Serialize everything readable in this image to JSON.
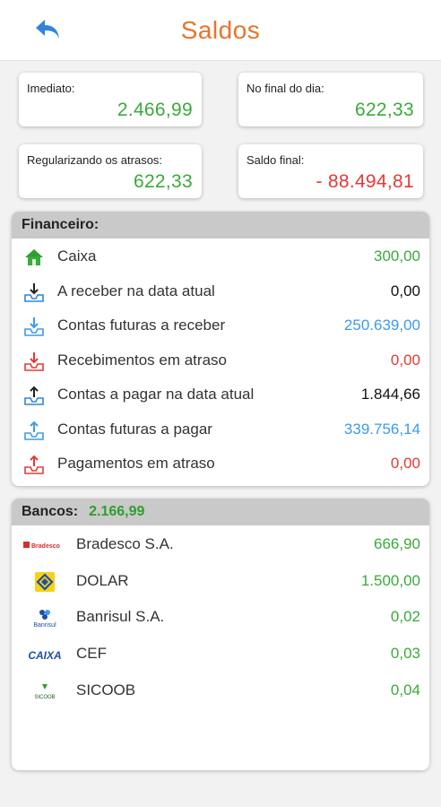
{
  "header": {
    "title": "Saldos",
    "back_icon": "back-arrow-icon"
  },
  "summary": {
    "imediato": {
      "label": "Imediato:",
      "value": "2.466,99"
    },
    "final_dia": {
      "label": "No final do dia:",
      "value": "622,33"
    },
    "regularizando": {
      "label": "Regularizando os atrasos:",
      "value": "622,33"
    },
    "saldo_final": {
      "label": "Saldo final:",
      "value": "- 88.494,81"
    }
  },
  "financeiro": {
    "title": "Financeiro:",
    "items": [
      {
        "label": "Caixa",
        "value": "300,00",
        "icon": "house-icon"
      },
      {
        "label": "A receber na data atual",
        "value": "0,00",
        "icon": "receive-today-icon"
      },
      {
        "label": "Contas futuras a receber",
        "value": "250.639,00",
        "icon": "receive-future-icon"
      },
      {
        "label": "Recebimentos em atraso",
        "value": "0,00",
        "icon": "receive-late-icon"
      },
      {
        "label": "Contas a pagar na data atual",
        "value": "1.844,66",
        "icon": "pay-today-icon"
      },
      {
        "label": "Contas futuras a pagar",
        "value": "339.756,14",
        "icon": "pay-future-icon"
      },
      {
        "label": "Pagamentos em atraso",
        "value": "0,00",
        "icon": "pay-late-icon"
      }
    ]
  },
  "bancos": {
    "title": "Bancos:",
    "total": "2.166,99",
    "items": [
      {
        "label": "Bradesco S.A.",
        "value": "666,90",
        "logo": "bradesco-logo",
        "logo_text": "Bradesco"
      },
      {
        "label": "DOLAR",
        "value": "1.500,00",
        "logo": "banco-do-brasil-logo"
      },
      {
        "label": "Banrisul S.A.",
        "value": "0,02",
        "logo": "banrisul-logo",
        "logo_text": "Banrisul"
      },
      {
        "label": "CEF",
        "value": "0,03",
        "logo": "caixa-logo",
        "logo_text": "CAIXA"
      },
      {
        "label": "SICOOB",
        "value": "0,04",
        "logo": "sicoob-logo",
        "logo_text": "SICOOB"
      }
    ]
  },
  "colors": {
    "accent": "#e8742a",
    "positive": "#3aaa3a",
    "negative": "#e53935",
    "future": "#3d9be9",
    "header_gray": "#c9c9c9"
  }
}
